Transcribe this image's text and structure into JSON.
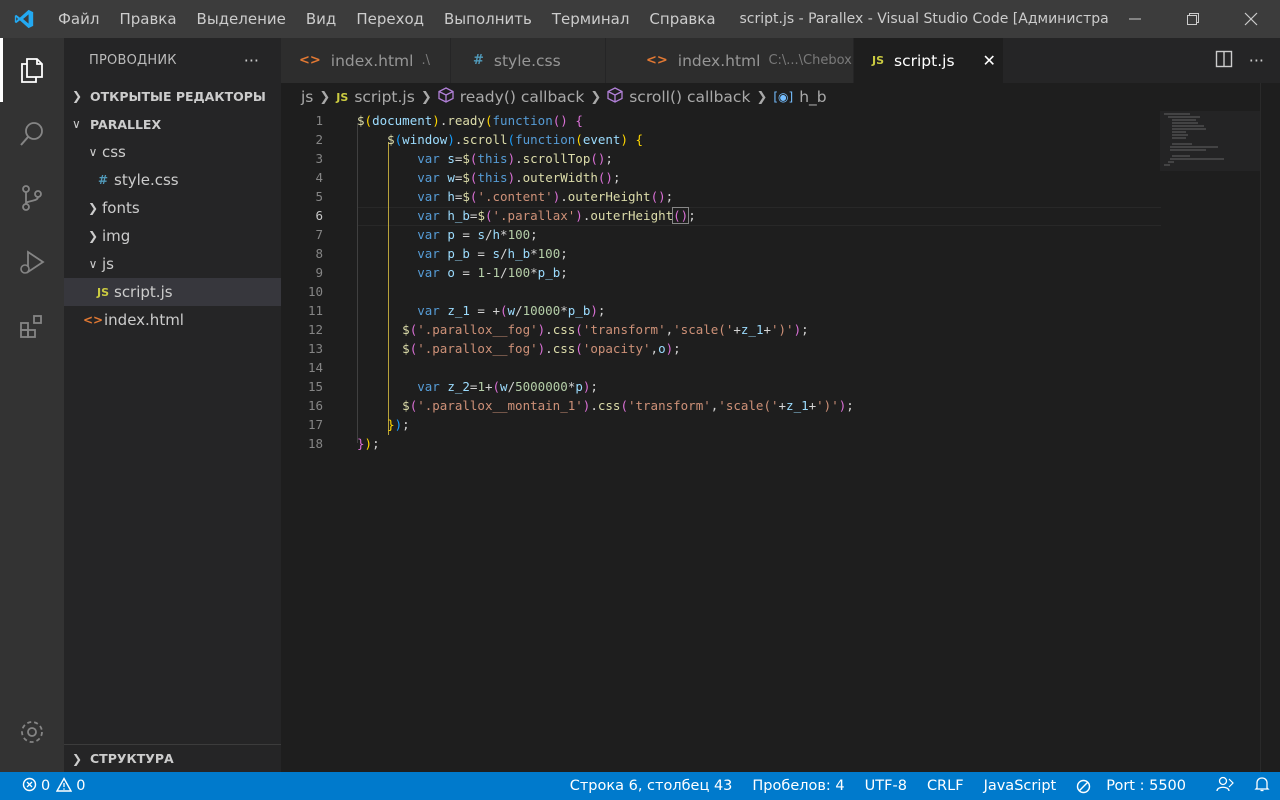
{
  "menu": [
    "Файл",
    "Правка",
    "Выделение",
    "Вид",
    "Переход",
    "Выполнить",
    "Терминал",
    "Справка"
  ],
  "window_title": "script.js - Parallex - Visual Studio Code [Администра...",
  "sidebar": {
    "title": "ПРОВОДНИК",
    "more": "···",
    "open_editors": "ОТКРЫТЫЕ РЕДАКТОРЫ",
    "project": "PARALLEX",
    "tree": [
      {
        "label": "css",
        "type": "folder",
        "open": true
      },
      {
        "label": "style.css",
        "type": "css"
      },
      {
        "label": "fonts",
        "type": "folder",
        "open": false
      },
      {
        "label": "img",
        "type": "folder",
        "open": false
      },
      {
        "label": "js",
        "type": "folder",
        "open": true
      },
      {
        "label": "script.js",
        "type": "js"
      },
      {
        "label": "index.html",
        "type": "html"
      }
    ],
    "outline": "СТРУКТУРА"
  },
  "tabs": [
    {
      "label": "index.html",
      "desc": ".\\",
      "icon": "<>",
      "color": "#e37933"
    },
    {
      "label": "style.css",
      "desc": "",
      "icon": "#",
      "color": "#519aba"
    },
    {
      "label": "index.html",
      "desc": "C:\\...\\Chebox",
      "icon": "<>",
      "color": "#e37933"
    },
    {
      "label": "script.js",
      "desc": "",
      "icon": "JS",
      "color": "#cbcb41"
    }
  ],
  "breadcrumb": [
    "js",
    "script.js",
    "ready() callback",
    "scroll() callback",
    "h_b"
  ],
  "editor": {
    "line_numbers": [
      "1",
      "2",
      "3",
      "4",
      "5",
      "6",
      "7",
      "8",
      "9",
      "10",
      "11",
      "12",
      "13",
      "14",
      "15",
      "16",
      "17",
      "18"
    ],
    "current_line": "6"
  },
  "status": {
    "errors": "0",
    "warnings": "0",
    "position": "Строка 6, столбец 43",
    "spaces": "Пробелов: 4",
    "encoding": "UTF-8",
    "eol": "CRLF",
    "language": "JavaScript",
    "port": "Port : 5500"
  }
}
